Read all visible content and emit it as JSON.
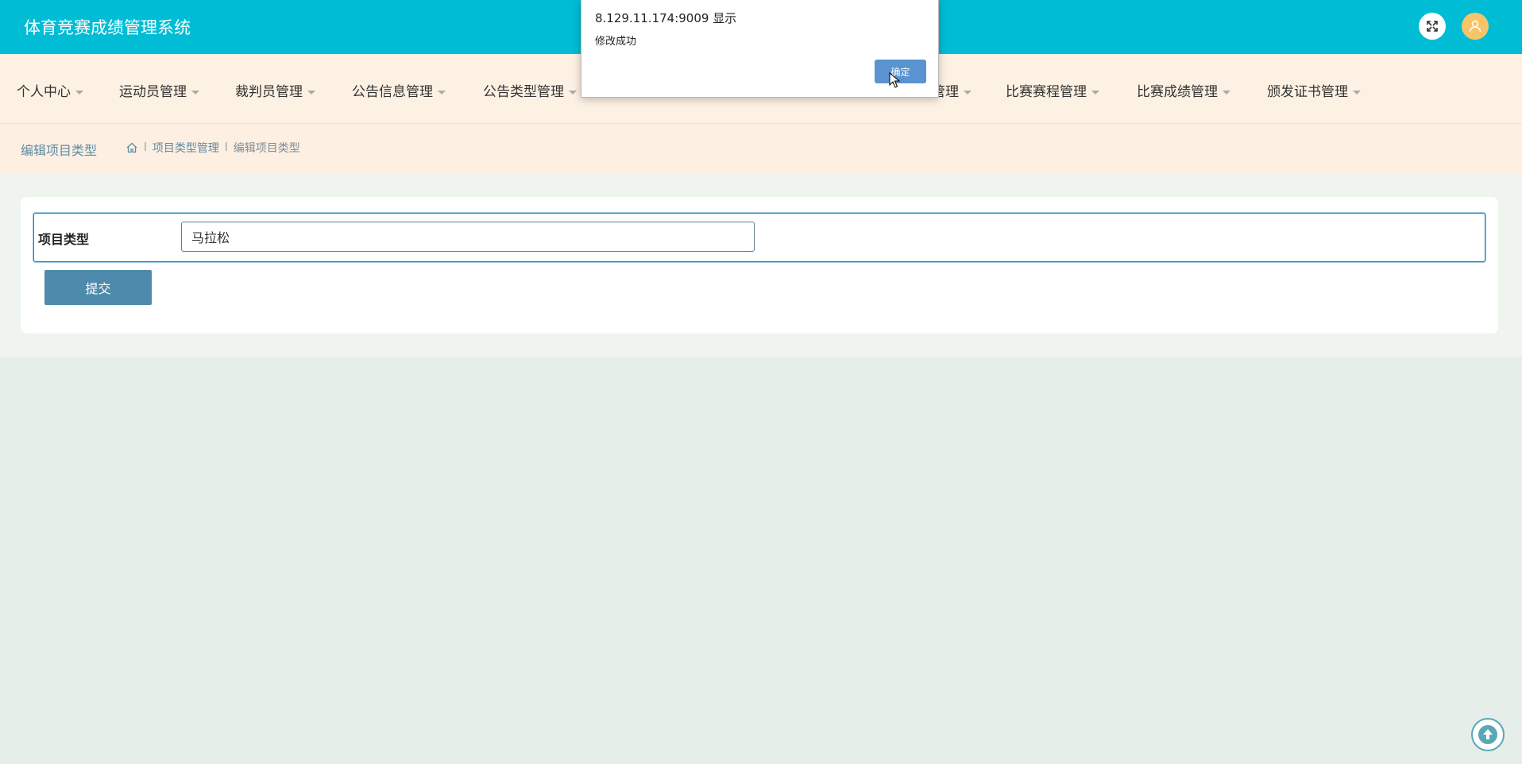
{
  "header": {
    "app_title": "体育竞赛成绩管理系统",
    "fullscreen_icon": "fullscreen-icon",
    "avatar_icon": "user-icon",
    "colors": {
      "header_bg": "#00bcd4",
      "avatar_bg": "#f5c46b"
    }
  },
  "nav": {
    "items": [
      {
        "label": "个人中心"
      },
      {
        "label": "运动员管理"
      },
      {
        "label": "裁判员管理"
      },
      {
        "label": "公告信息管理"
      },
      {
        "label": "公告类型管理"
      },
      {
        "label": "管理"
      },
      {
        "label": "比赛赛程管理"
      },
      {
        "label": "比赛成绩管理"
      },
      {
        "label": "颁发证书管理"
      }
    ]
  },
  "breadcrumb": {
    "page_title": "编辑项目类型",
    "home_icon": "home-icon",
    "separator": "l",
    "parent": "项目类型管理",
    "current": "编辑项目类型"
  },
  "form": {
    "field_label": "项目类型",
    "field_value": "马拉松",
    "submit_label": "提交"
  },
  "dialog": {
    "origin": "8.129.11.174:9009 显示",
    "message": "修改成功",
    "ok_label": "确定"
  },
  "back_to_top_icon": "arrow-up-icon"
}
